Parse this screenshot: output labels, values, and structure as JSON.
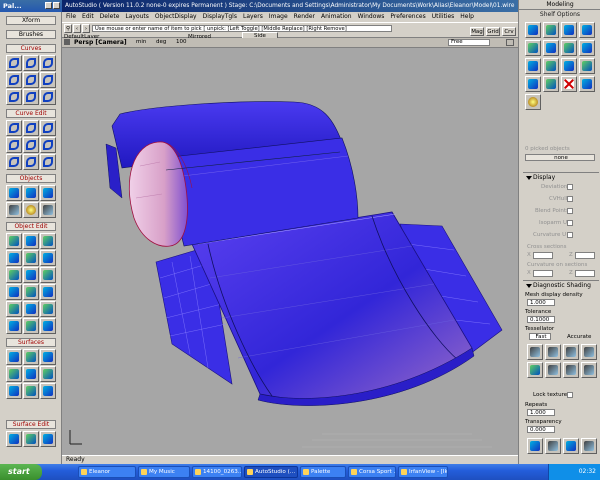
{
  "palette": {
    "title": "Pal...",
    "sections": {
      "xform": "Xform",
      "brushes": "Brushes",
      "curves": "Curves",
      "curve_edit": "Curve Edit",
      "objects": "Objects",
      "object_edit": "Object Edit",
      "surfaces": "Surfaces",
      "surface_edit": "Surface Edit"
    }
  },
  "window": {
    "title": "AutoStudio ( Version 11.0.2 none-0 expires Permanent ) Stage: C:\\Documents and Settings\\Administrator\\My Documents\\Work\\Alias\\Eleanor\\Model\\01.wire"
  },
  "menu": [
    "File",
    "Edit",
    "Delete",
    "Layouts",
    "ObjectDisplay",
    "DisplayTgls",
    "Layers",
    "Image",
    "Render",
    "Animation",
    "Windows",
    "Preferences",
    "Utilities",
    "Help"
  ],
  "toolbar": {
    "prompt": "Use mouse or enter name of item to pick [ unpick: [Left Toggle] [Middle Replace] [Right Remove]",
    "layer": "DefaultLayer",
    "symmetry": "Mirrored",
    "side": "Side",
    "mag": "Mag",
    "grid": "Grid",
    "crv": "Crv",
    "free": "Free"
  },
  "viewport": {
    "label": "Persp [Camera]",
    "min_label": "min",
    "deg_label": "deg",
    "value_label": "100"
  },
  "shelf": {
    "title": "Modeling",
    "options": "Shelf Options"
  },
  "control_panel": {
    "picked": "0 picked objects",
    "none": "none",
    "display_header": "Display",
    "deviation": "Deviation",
    "cvhull": "CVHull",
    "blend_points": "Blend Points",
    "isoparm_u": "Isoparm U",
    "curvature_u": "Curvature U",
    "cross_sections": "Cross sections",
    "curvature_on_sections": "Curvature on sections",
    "x_label": "X",
    "z_label": "Z",
    "diag_header": "Diagnostic Shading",
    "mesh_density_label": "Mesh display density",
    "mesh_density_value": "1.000",
    "tolerance_label": "Tolerance",
    "tolerance_value": "0.1000",
    "tessellator_label": "Tessellator",
    "fast": "Fast",
    "accurate": "Accurate",
    "lock_texture": "Lock texture",
    "repeats_label": "Repeats",
    "repeats_value": "1.000",
    "transparency_label": "Transparency",
    "transparency_value": "0.000"
  },
  "status": {
    "text": "Ready"
  },
  "taskbar": {
    "start": "start",
    "tasks": [
      "Eleanor",
      "My Music",
      "14100_0263...",
      "AutoStudio (...",
      "Palette",
      "Corsa Sport ...",
      "IrfanView - [Ik..."
    ],
    "clock": "02:32"
  },
  "colors": {
    "surface_blue": "#3a28e0",
    "viewport_bg": "#a6a6a6",
    "taskbar_blue": "#245edb"
  }
}
